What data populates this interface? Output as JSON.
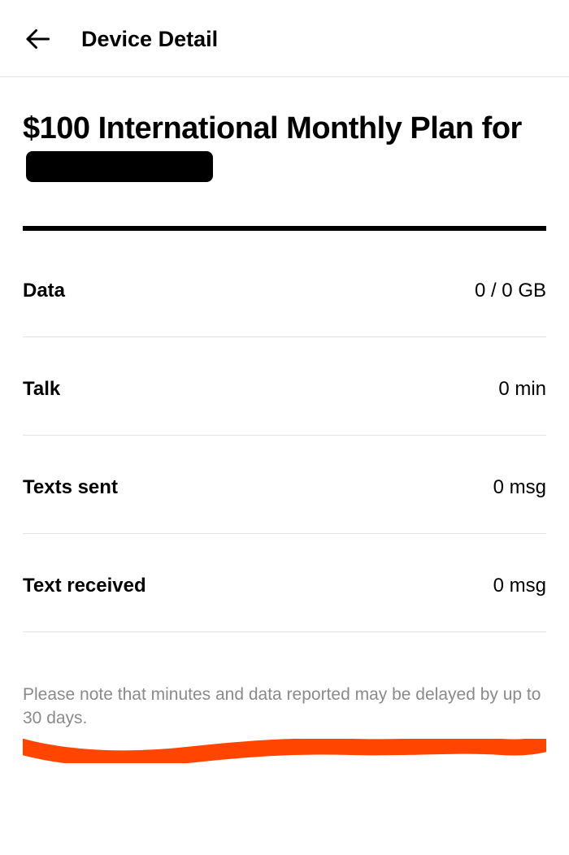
{
  "header": {
    "title": "Device Detail"
  },
  "plan": {
    "title_prefix": "$100 International Monthly Plan for"
  },
  "usage": {
    "items": [
      {
        "label": "Data",
        "value": "0 / 0 GB"
      },
      {
        "label": "Talk",
        "value": "0 min"
      },
      {
        "label": "Texts sent",
        "value": "0 msg"
      },
      {
        "label": "Text received",
        "value": "0 msg"
      }
    ]
  },
  "disclaimer": "Please note that minutes and data reported may be delayed by up to 30 days."
}
